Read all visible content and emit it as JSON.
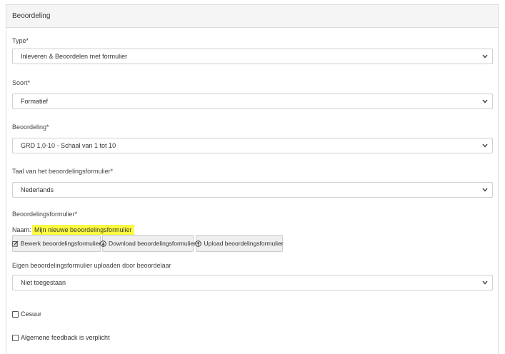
{
  "panel": {
    "title": "Beoordeling"
  },
  "fields": {
    "type": {
      "label": "Type*",
      "value": "Inleveren & Beoordelen met formulier"
    },
    "soort": {
      "label": "Soort*",
      "value": "Formatief"
    },
    "beoordeling": {
      "label": "Beoordeling*",
      "value": "GRD 1,0-10 - Schaal van 1 tot 10"
    },
    "taal": {
      "label": "Taal van het beoordelingsformulier*",
      "value": "Nederlands"
    },
    "formulier": {
      "label": "Beoordelingsformulier*",
      "naam_prefix": "Naam:",
      "naam_value": "Mijn nieuwe beoordelingsformulier"
    },
    "eigen": {
      "label": "Eigen beoordelingsformulier uploaden door beoordelaar",
      "value": "Niet toegestaan"
    }
  },
  "buttons": {
    "edit": {
      "label": "Bewerk beoordelingsformulier",
      "icon": "edit-icon"
    },
    "download": {
      "label": "Download beoordelingsformulier",
      "icon": "download-icon"
    },
    "upload": {
      "label": "Upload beoordelingsformulier",
      "icon": "upload-icon"
    }
  },
  "checkboxes": {
    "cesuur": {
      "label": "Cesuur",
      "checked": false
    },
    "feedback": {
      "label": "Algemene feedback is verplicht",
      "checked": false
    }
  }
}
